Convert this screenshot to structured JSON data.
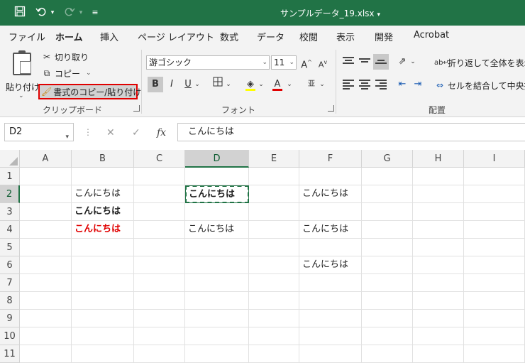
{
  "titlebar": {
    "title": "サンプルデータ_19.xlsx",
    "icons": [
      "save-icon",
      "undo-icon",
      "redo-icon",
      "customize-icon"
    ]
  },
  "tabs": [
    "ファイル",
    "ホーム",
    "挿入",
    "ページ レイアウト",
    "数式",
    "データ",
    "校閲",
    "表示",
    "開発",
    "Acrobat"
  ],
  "active_tab": "ホーム",
  "ribbon": {
    "clipboard": {
      "paste": "貼り付け",
      "cut": "切り取り",
      "copy": "コピー",
      "format_painter": "書式のコピー/貼り付け",
      "group_label": "クリップボード"
    },
    "font": {
      "font_name": "游ゴシック",
      "font_size": "11",
      "group_label": "フォント",
      "bold": "B",
      "italic": "I",
      "underline": "U"
    },
    "alignment": {
      "wrap_text": "折り返して全体を表示す",
      "merge_center": "セルを結合して中央揃え",
      "group_label": "配置"
    }
  },
  "formula_bar": {
    "name_box": "D2",
    "formula": "こんにちは"
  },
  "grid": {
    "columns": [
      "A",
      "B",
      "C",
      "D",
      "E",
      "F",
      "G",
      "H",
      "I"
    ],
    "rows": [
      "1",
      "2",
      "3",
      "4",
      "5",
      "6",
      "7",
      "8",
      "9",
      "10",
      "11"
    ],
    "selected_column": "D",
    "selected_row": "2",
    "cells": {
      "B2": "こんにちは",
      "D2": "こんにちは",
      "F2": "こんにちは",
      "B3": "こんにちは",
      "B4": "こんにちは",
      "D4": "こんにちは",
      "F4": "こんにちは",
      "F6": "こんにちは"
    }
  },
  "colors": {
    "excel_green": "#217346",
    "highlight_red": "#e00000"
  }
}
